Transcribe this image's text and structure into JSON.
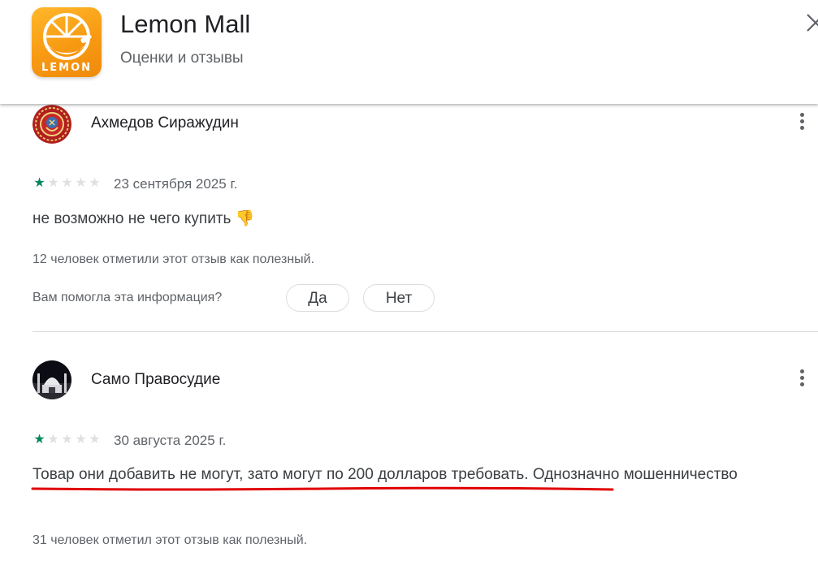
{
  "app": {
    "name": "Lemon Mall",
    "subtitle": "Оценки и отзывы",
    "icon_label": "LEMON",
    "icon_name": "lemon-app-icon",
    "brand_color": "#f79a12"
  },
  "header": {
    "close_icon": "close-icon"
  },
  "reviews": [
    {
      "author": "Ахмедов Сиражудин",
      "avatar_icon": "emblem-avatar",
      "rating": 1,
      "max_rating": 5,
      "date": "23 сентября 2025 г.",
      "text": "не возможно не чего купить",
      "emoji": "👎",
      "helpful": "12 человек отметили этот отзыв как полезный.",
      "helpful_question": "Вам помогла эта информация?",
      "yes_label": "Да",
      "no_label": "Нет"
    },
    {
      "author": "Само Правосудие",
      "avatar_icon": "mosque-avatar",
      "rating": 1,
      "max_rating": 5,
      "date": "30 августа 2025 г.",
      "text_highlighted": "Товар они добавить не могут, зато могут по 200 долларов требовать.",
      "text_rest": " Однозначно мошенничество",
      "helpful": "31 человек отметил этот отзыв как полезный."
    }
  ],
  "colors": {
    "star_on": "#01875f",
    "star_off": "#e0e0e0",
    "underline_annotation": "#e00000"
  }
}
